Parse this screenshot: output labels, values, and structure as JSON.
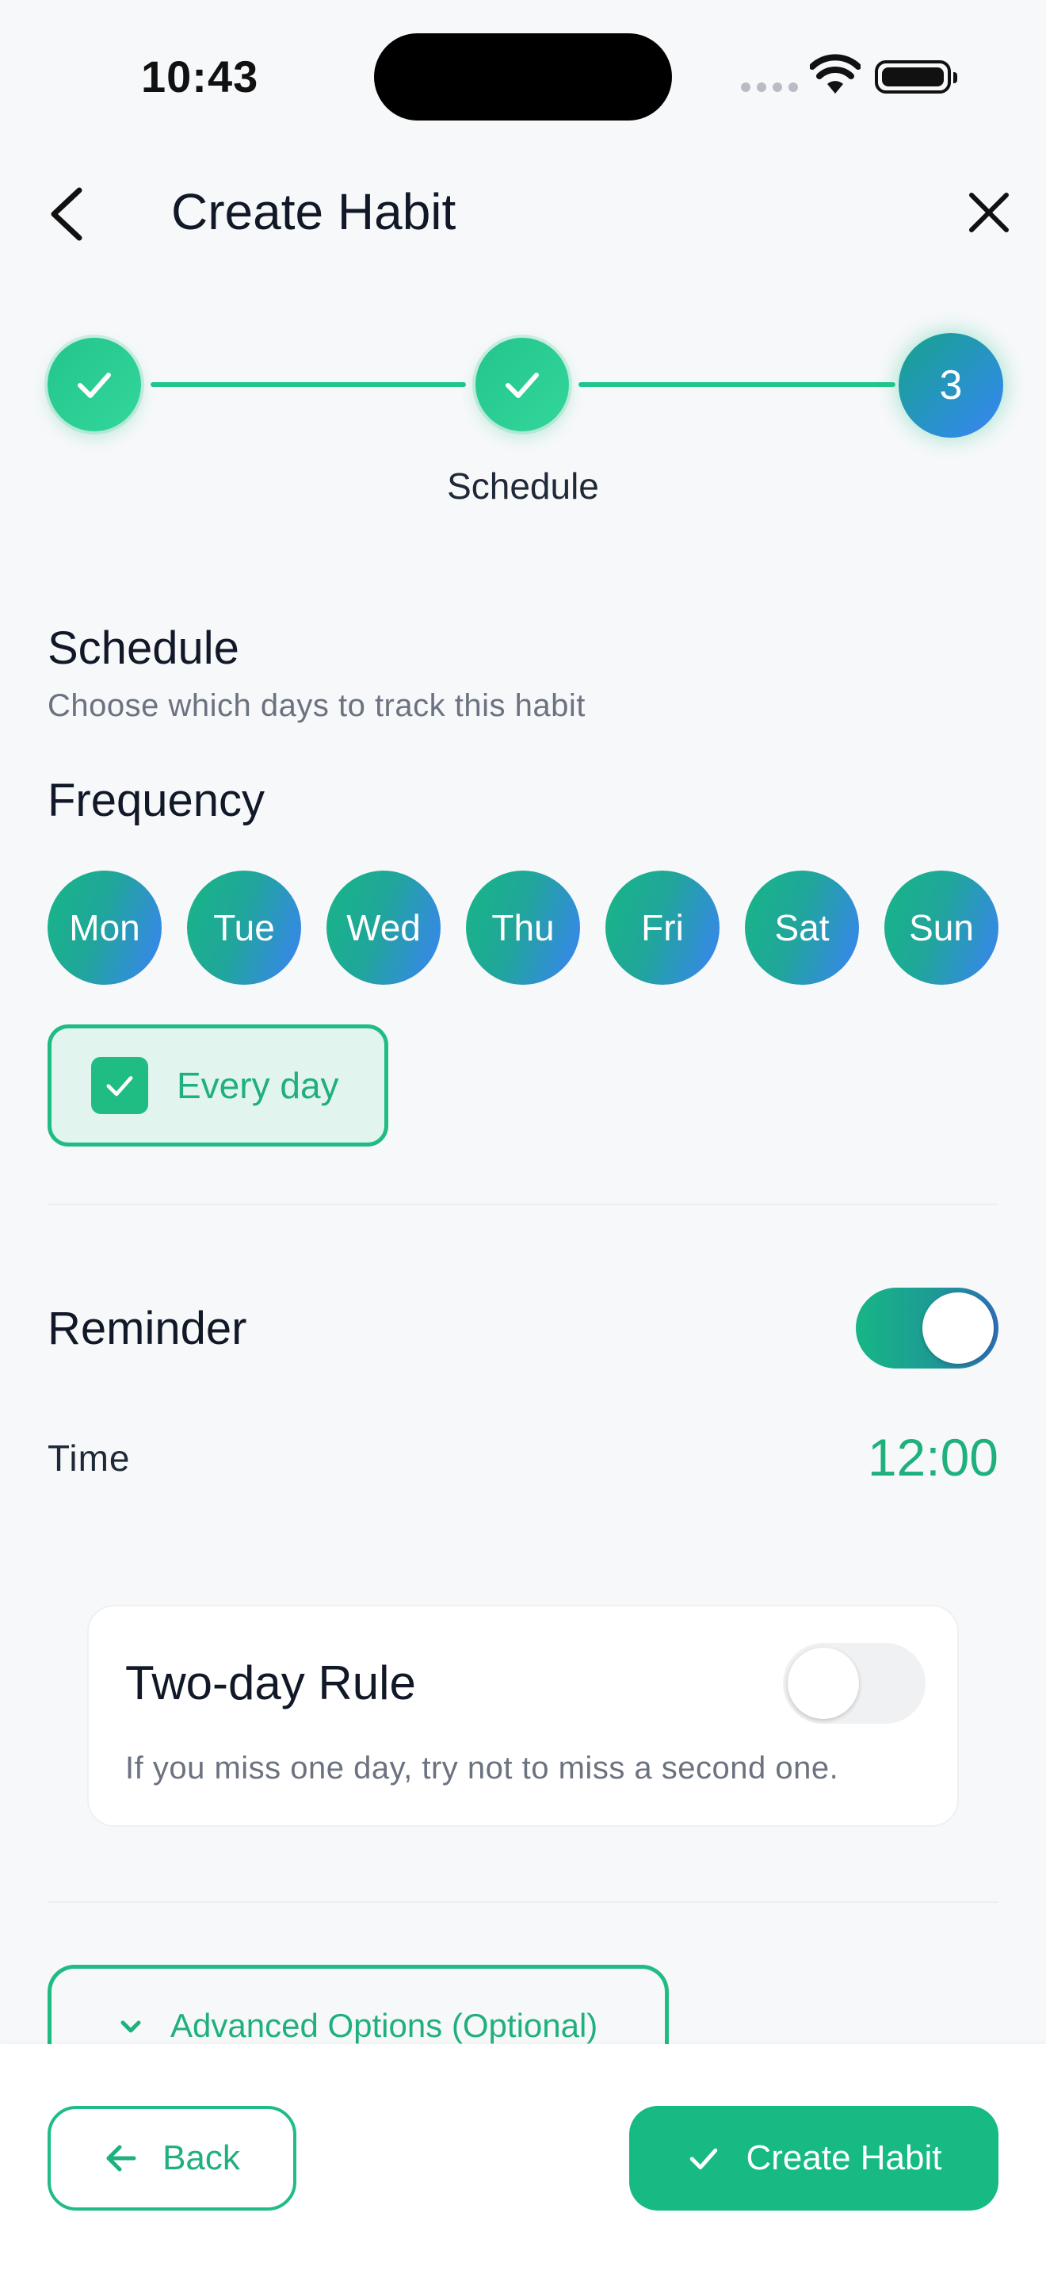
{
  "status_bar": {
    "time": "10:43"
  },
  "header": {
    "title": "Create Habit"
  },
  "stepper": {
    "steps": [
      "",
      "",
      "3"
    ],
    "current_label": "Schedule"
  },
  "schedule": {
    "title": "Schedule",
    "subtitle": "Choose which days to track this habit",
    "frequency_label": "Frequency",
    "days": [
      "Mon",
      "Tue",
      "Wed",
      "Thu",
      "Fri",
      "Sat",
      "Sun"
    ],
    "every_day_label": "Every day",
    "every_day_checked": true
  },
  "reminder": {
    "label": "Reminder",
    "enabled": true,
    "time_label": "Time",
    "time_value": "12:00"
  },
  "two_day_rule": {
    "title": "Two-day Rule",
    "description": "If you miss one day, try not to miss a second one.",
    "enabled": false
  },
  "advanced": {
    "label": "Advanced Options (Optional)"
  },
  "footer": {
    "back_label": "Back",
    "create_label": "Create Habit"
  },
  "colors": {
    "accent": "#1fbc84",
    "gradient_end": "#3b82f6",
    "background": "#f7f8fa"
  }
}
